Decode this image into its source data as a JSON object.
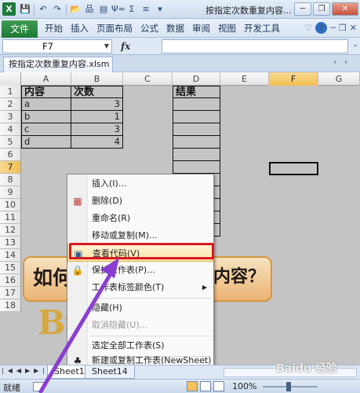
{
  "titlebar": {
    "app_icon": "X",
    "title": "按指定次数重复内容...",
    "quick_access": [
      "save-icon",
      "undo-icon",
      "redo-icon",
      "open-icon",
      "tree-icon",
      "format-icon",
      "sort-icon",
      "sum-icon",
      "filter-icon",
      "customize-icon"
    ],
    "quick_glyphs": [
      "💾",
      "↶",
      "↷",
      "📂",
      "品",
      "▤",
      "Ψ=",
      "Σ",
      "≡",
      "▾"
    ],
    "window_buttons": {
      "minimize": "─",
      "restore": "❐",
      "close": "✕"
    }
  },
  "ribbon": {
    "file_tab": "文件",
    "tabs": [
      "开始",
      "插入",
      "页面布局",
      "公式",
      "数据",
      "审阅",
      "视图",
      "开发工具"
    ],
    "help": "?"
  },
  "formula_bar": {
    "name_box": "F7",
    "fx": "fx",
    "formula": ""
  },
  "document": {
    "tab": "按指定次数重复内容.xlsm"
  },
  "grid": {
    "columns": [
      "A",
      "B",
      "C",
      "D",
      "E",
      "F",
      "G"
    ],
    "rows": [
      "1",
      "2",
      "3",
      "4",
      "5",
      "6",
      "7",
      "8",
      "9",
      "10",
      "11",
      "12",
      "13",
      "14",
      "15",
      "16",
      "17",
      "18"
    ],
    "cells": {
      "A1": "内容",
      "B1": "次数",
      "D1": "结果",
      "A2": "a",
      "B2": "3",
      "A3": "b",
      "B3": "1",
      "A4": "c",
      "B4": "3",
      "A5": "d",
      "B5": "4"
    }
  },
  "banner": {
    "left": "如何",
    "right": "内容？",
    "by": "By"
  },
  "context_menu": {
    "items": [
      {
        "label": "插入(I)...",
        "icon": "",
        "arrow": "",
        "disabled": false
      },
      {
        "label": "删除(D)",
        "icon": "delete-sheet-icon",
        "arrow": "",
        "disabled": false
      },
      {
        "label": "重命名(R)",
        "icon": "",
        "arrow": "",
        "disabled": false
      },
      {
        "label": "移动或复制(M)...",
        "icon": "",
        "arrow": "",
        "disabled": false
      },
      {
        "label": "查看代码(V)",
        "icon": "view-code-icon",
        "arrow": "",
        "disabled": false
      },
      {
        "label": "保护工作表(P)...",
        "icon": "protect-sheet-icon",
        "arrow": "",
        "disabled": false
      },
      {
        "label": "工作表标签颜色(T)",
        "icon": "",
        "arrow": "▶",
        "disabled": false
      },
      {
        "label": "隐藏(H)",
        "icon": "",
        "arrow": "",
        "disabled": false
      },
      {
        "label": "取消隐藏(U)...",
        "icon": "",
        "arrow": "",
        "disabled": true
      },
      {
        "label": "选定全部工作表(S)",
        "icon": "",
        "arrow": "",
        "disabled": false
      },
      {
        "label": "新建或复制工作表(NewSheet)",
        "icon": "new-sheet-icon",
        "arrow": "",
        "disabled": false
      }
    ],
    "highlighted": "查看代码(V)"
  },
  "sheets": {
    "tabs": [
      "Sheet1",
      "Sheet14"
    ],
    "active": "Sheet1"
  },
  "status": {
    "ready": "就绪",
    "zoom": "100%"
  },
  "watermark": "Baidu 经验"
}
